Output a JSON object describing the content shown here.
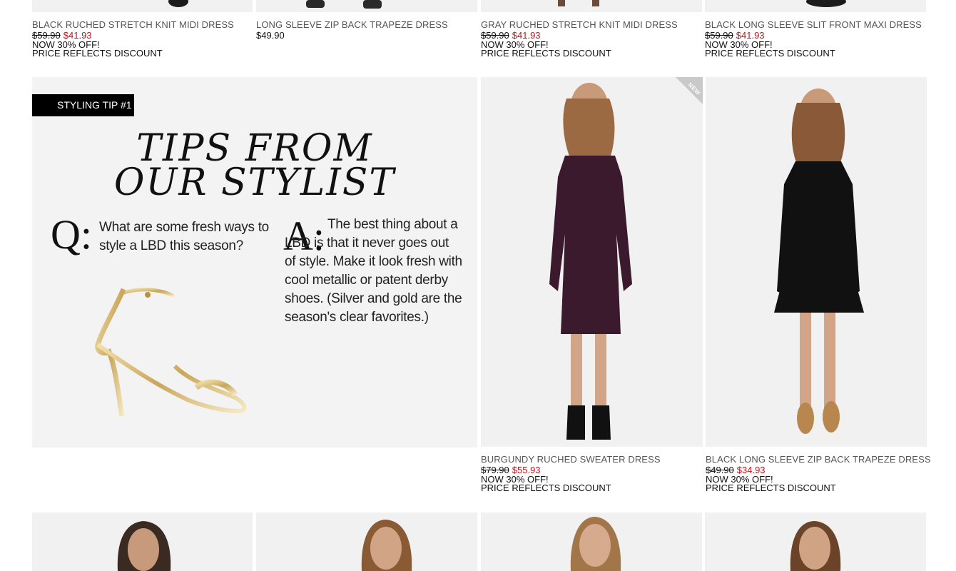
{
  "products_top": [
    {
      "name": "BLACK RUCHED STRETCH KNIT MIDI DRESS",
      "was_price": "$59.90",
      "sale_price": "$41.93",
      "promo1": "NOW 30% OFF!",
      "promo2": "PRICE REFLECTS DISCOUNT"
    },
    {
      "name": "LONG SLEEVE ZIP BACK TRAPEZE DRESS",
      "price": "$49.90"
    },
    {
      "name": "GRAY RUCHED STRETCH KNIT MIDI DRESS",
      "was_price": "$59.90",
      "sale_price": "$41.93",
      "promo1": "NOW 30% OFF!",
      "promo2": "PRICE REFLECTS DISCOUNT"
    },
    {
      "name": "BLACK LONG SLEEVE SLIT FRONT MAXI DRESS",
      "was_price": "$59.90",
      "sale_price": "$41.93",
      "promo1": "NOW 30% OFF!",
      "promo2": "PRICE REFLECTS DISCOUNT"
    }
  ],
  "styling_tip": {
    "badge": "STYLING TIP #1",
    "heading_line1": "TIPS FROM",
    "heading_line2": "OUR STYLIST",
    "q_letter": "Q:",
    "question": "What are some fresh ways to style a LBD this season?",
    "a_letter": "A:",
    "answer": "The best thing about a LBD is that it never goes out of style. Make it look fresh with cool metallic or patent derby shoes. (Silver and gold are the season's clear favorites.)"
  },
  "products_mid": [
    {
      "name": "BURGUNDY RUCHED SWEATER DRESS",
      "was_price": "$79.90",
      "sale_price": "$55.93",
      "promo1": "NOW 30% OFF!",
      "promo2": "PRICE REFLECTS DISCOUNT",
      "badge": "NEW",
      "dress_color": "#3a1a2c"
    },
    {
      "name": "BLACK LONG SLEEVE ZIP BACK TRAPEZE DRESS",
      "was_price": "$49.90",
      "sale_price": "$34.93",
      "promo1": "NOW 30% OFF!",
      "promo2": "PRICE REFLECTS DISCOUNT",
      "dress_color": "#111111"
    }
  ],
  "colors": {
    "sale_price": "#d0111b",
    "product_name": "#555555",
    "tile_bg": "#f1f1f1",
    "badge_bg": "#000000"
  }
}
